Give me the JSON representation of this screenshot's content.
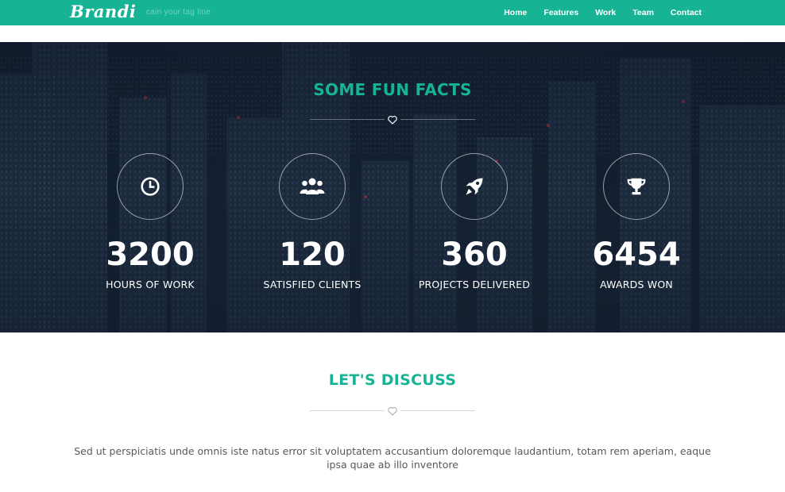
{
  "navbar": {
    "brand": "Brandi",
    "tagline": "cain your tag line",
    "links": [
      "Home",
      "Features",
      "Work",
      "Team",
      "Contact"
    ]
  },
  "facts": {
    "title": "SOME FUN FACTS",
    "items": [
      {
        "icon": "clock-icon",
        "value": "3200",
        "label": "HOURS OF WORK"
      },
      {
        "icon": "users-icon",
        "value": "120",
        "label": "SATISFIED CLIENTS"
      },
      {
        "icon": "rocket-icon",
        "value": "360",
        "label": "PROJECTS DELIVERED"
      },
      {
        "icon": "trophy-icon",
        "value": "6454",
        "label": "AWARDS WON"
      }
    ]
  },
  "discuss": {
    "title": "LET'S DISCUSS",
    "text": "Sed ut perspiciatis unde omnis iste natus error sit voluptatem accusantium doloremque laudantium, totam rem aperiam, eaque ipsa quae ab illo inventore"
  },
  "colors": {
    "accent": "#16b394",
    "dark_overlay": "#172436",
    "body_text": "#555a5e"
  }
}
